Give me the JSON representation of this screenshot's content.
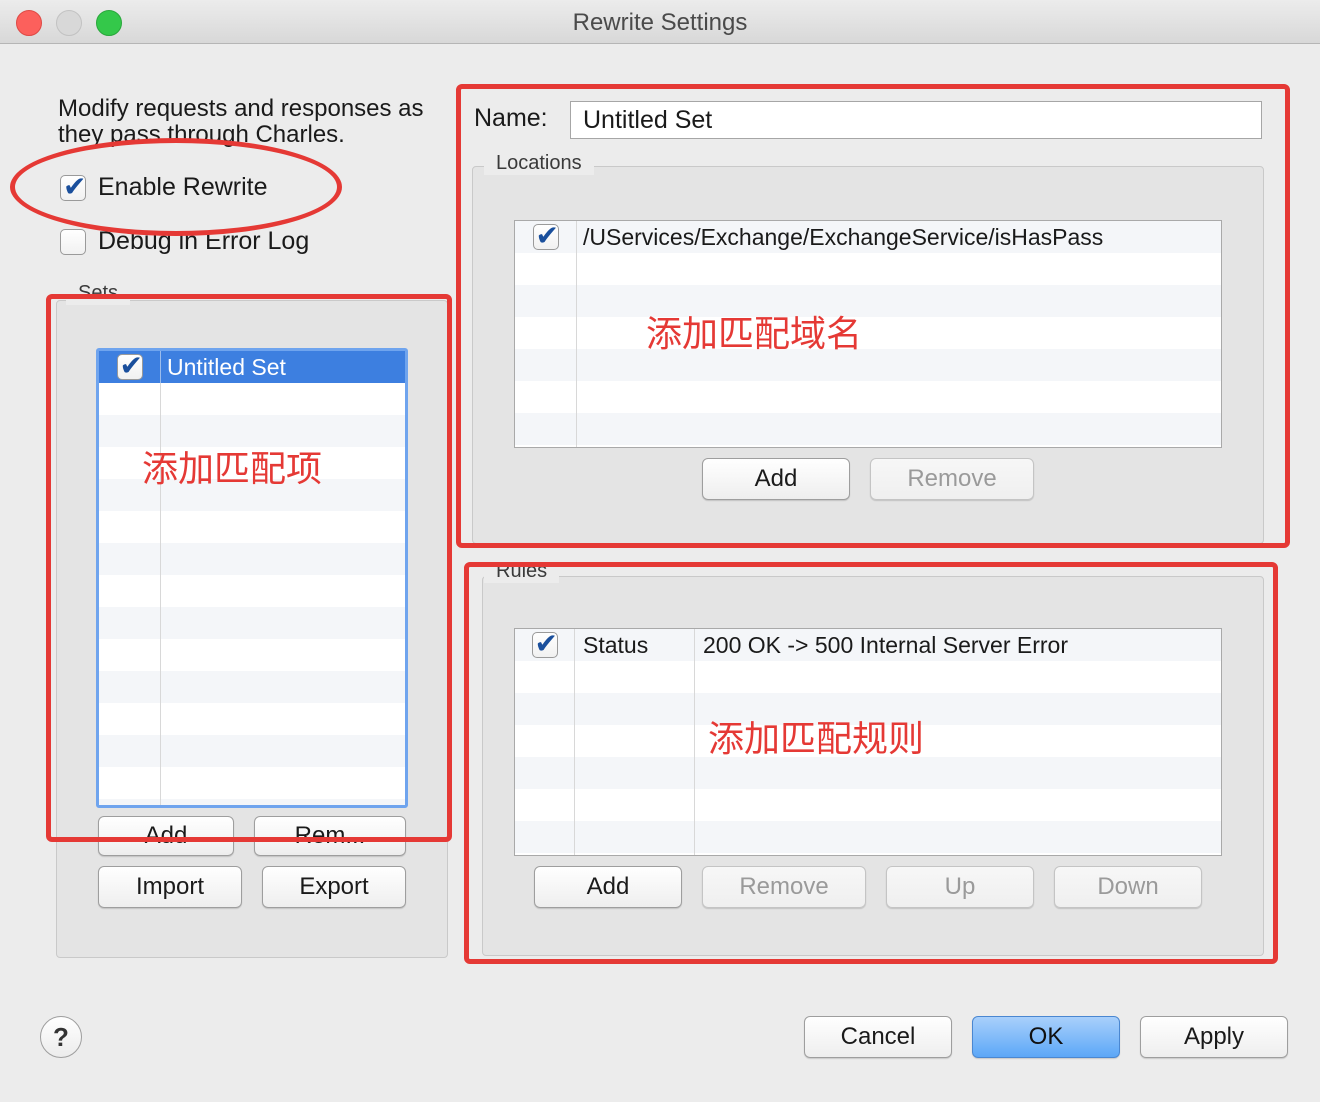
{
  "window": {
    "title": "Rewrite Settings"
  },
  "intro": {
    "text": "Modify requests and responses as they pass through Charles."
  },
  "enable_rewrite": {
    "label": "Enable Rewrite",
    "checked": true
  },
  "debug_error_log": {
    "label": "Debug in Error Log",
    "checked": false
  },
  "sets": {
    "legend": "Sets",
    "items": [
      {
        "label": "Untitled Set",
        "checked": true,
        "selected": true
      }
    ],
    "add_label": "Add",
    "remove_label": "Rem...",
    "import_label": "Import",
    "export_label": "Export"
  },
  "name_field": {
    "label": "Name:",
    "value": "Untitled Set"
  },
  "locations": {
    "legend": "Locations",
    "items": [
      {
        "label": "/UServices/Exchange/ExchangeService/isHasPass",
        "checked": true
      }
    ],
    "add_label": "Add",
    "remove_label": "Remove"
  },
  "rules": {
    "legend": "Rules",
    "items": [
      {
        "type": "Status",
        "description": "200 OK -> 500 Internal Server Error",
        "checked": true
      }
    ],
    "add_label": "Add",
    "remove_label": "Remove",
    "up_label": "Up",
    "down_label": "Down"
  },
  "annotations": {
    "sets": "添加匹配项",
    "locations": "添加匹配域名",
    "rules": "添加匹配规则"
  },
  "footer": {
    "help_label": "?",
    "cancel_label": "Cancel",
    "ok_label": "OK",
    "apply_label": "Apply"
  },
  "colors": {
    "annotation_red": "#e53935",
    "selection_blue": "#3d7fe0",
    "checkmark": "#1a4f9c"
  }
}
